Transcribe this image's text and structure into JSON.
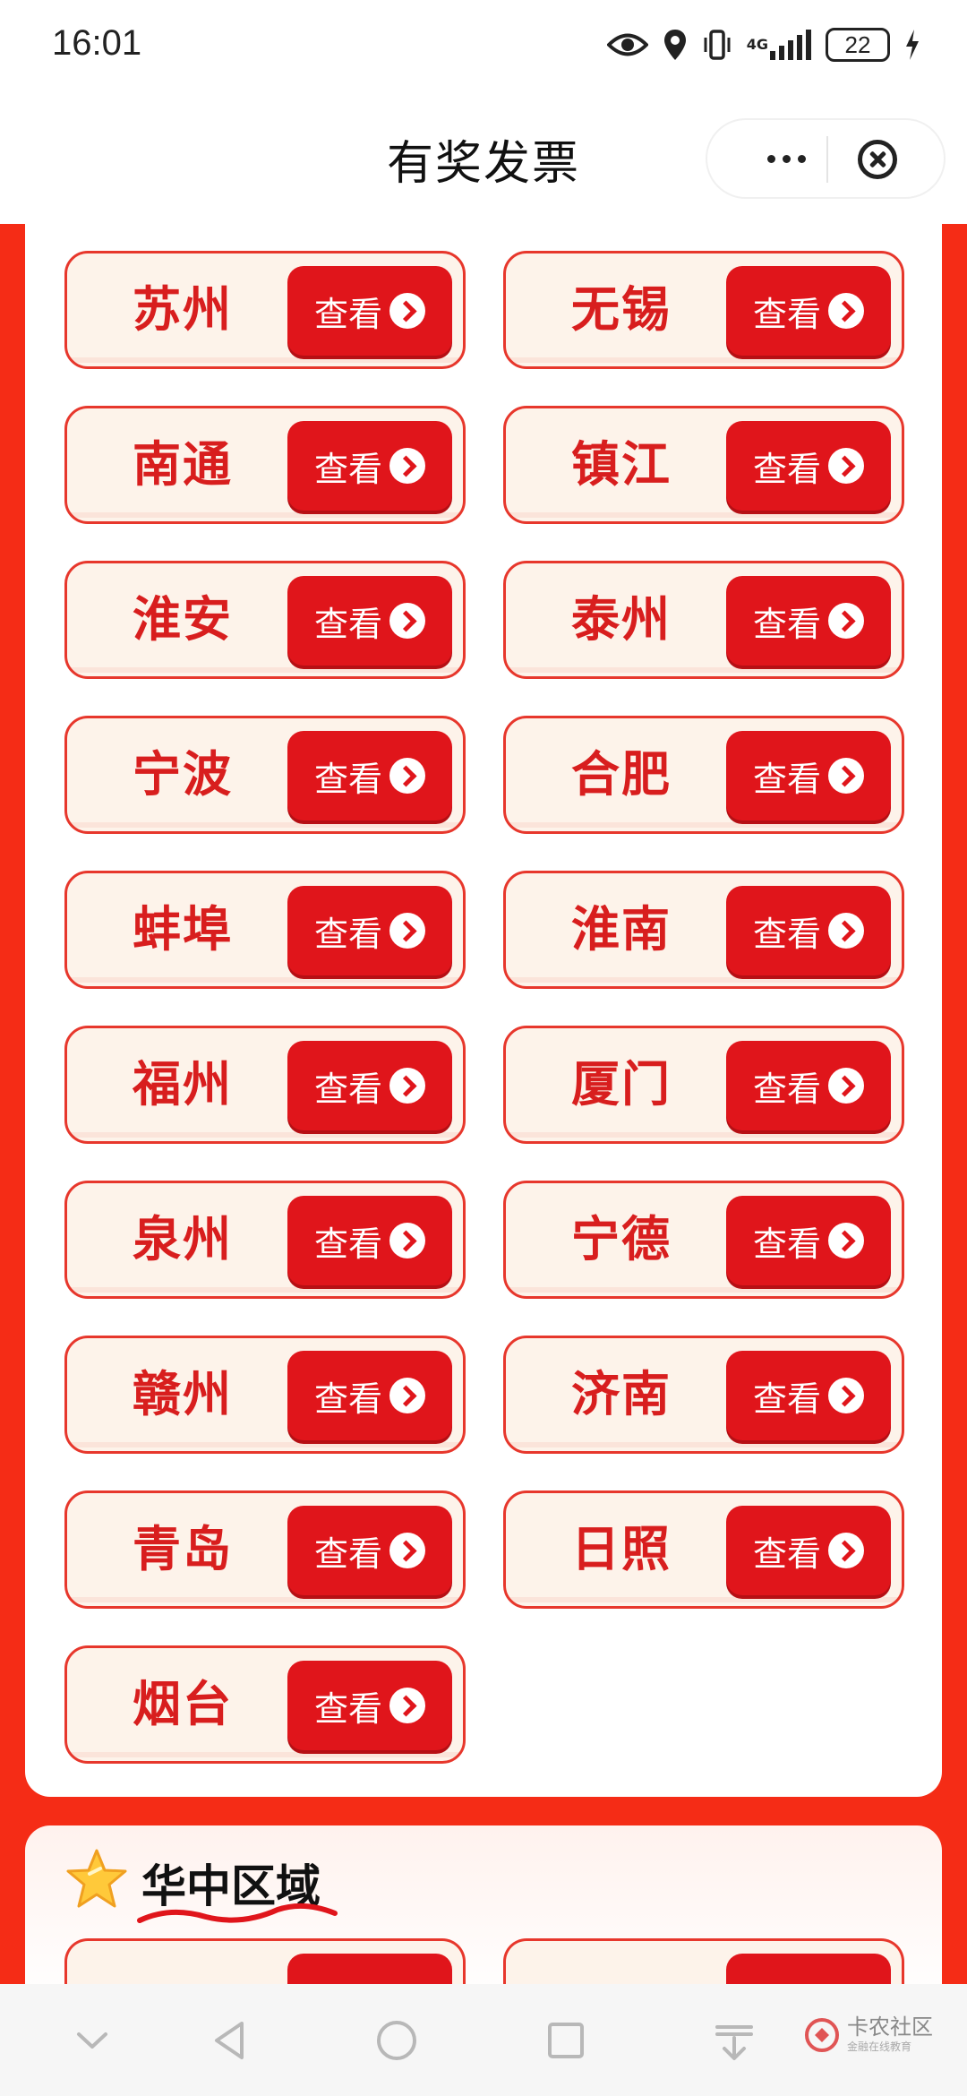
{
  "status_bar": {
    "time": "16:01",
    "network": "4G",
    "battery": "22",
    "icons": [
      "eye-icon",
      "location-icon",
      "vibrate-icon",
      "signal-icon",
      "battery-icon",
      "charging-icon"
    ]
  },
  "nav": {
    "title": "有奖发票",
    "more_icon": "more-dots-icon",
    "close_icon": "close-circle-icon"
  },
  "colors": {
    "accent_red": "#f52c16",
    "button_red": "#e0151b",
    "city_text": "#d81e1e",
    "card_bg": "#fdf3ea"
  },
  "cities": [
    {
      "name": "苏州",
      "button": "查看"
    },
    {
      "name": "无锡",
      "button": "查看"
    },
    {
      "name": "南通",
      "button": "查看"
    },
    {
      "name": "镇江",
      "button": "查看"
    },
    {
      "name": "淮安",
      "button": "查看"
    },
    {
      "name": "泰州",
      "button": "查看"
    },
    {
      "name": "宁波",
      "button": "查看"
    },
    {
      "name": "合肥",
      "button": "查看"
    },
    {
      "name": "蚌埠",
      "button": "查看"
    },
    {
      "name": "淮南",
      "button": "查看"
    },
    {
      "name": "福州",
      "button": "查看"
    },
    {
      "name": "厦门",
      "button": "查看"
    },
    {
      "name": "泉州",
      "button": "查看"
    },
    {
      "name": "宁德",
      "button": "查看"
    },
    {
      "name": "赣州",
      "button": "查看"
    },
    {
      "name": "济南",
      "button": "查看"
    },
    {
      "name": "青岛",
      "button": "查看"
    },
    {
      "name": "日照",
      "button": "查看"
    },
    {
      "name": "烟台",
      "button": "查看"
    }
  ],
  "section2": {
    "title": "华中区域",
    "icon": "star-icon"
  },
  "bottom_nav": {
    "icons": [
      "chevron-down-icon",
      "back-triangle-icon",
      "home-circle-icon",
      "recents-square-icon",
      "download-icon"
    ],
    "watermark": "卡农社区",
    "watermark_sub": "金融在线教育"
  }
}
